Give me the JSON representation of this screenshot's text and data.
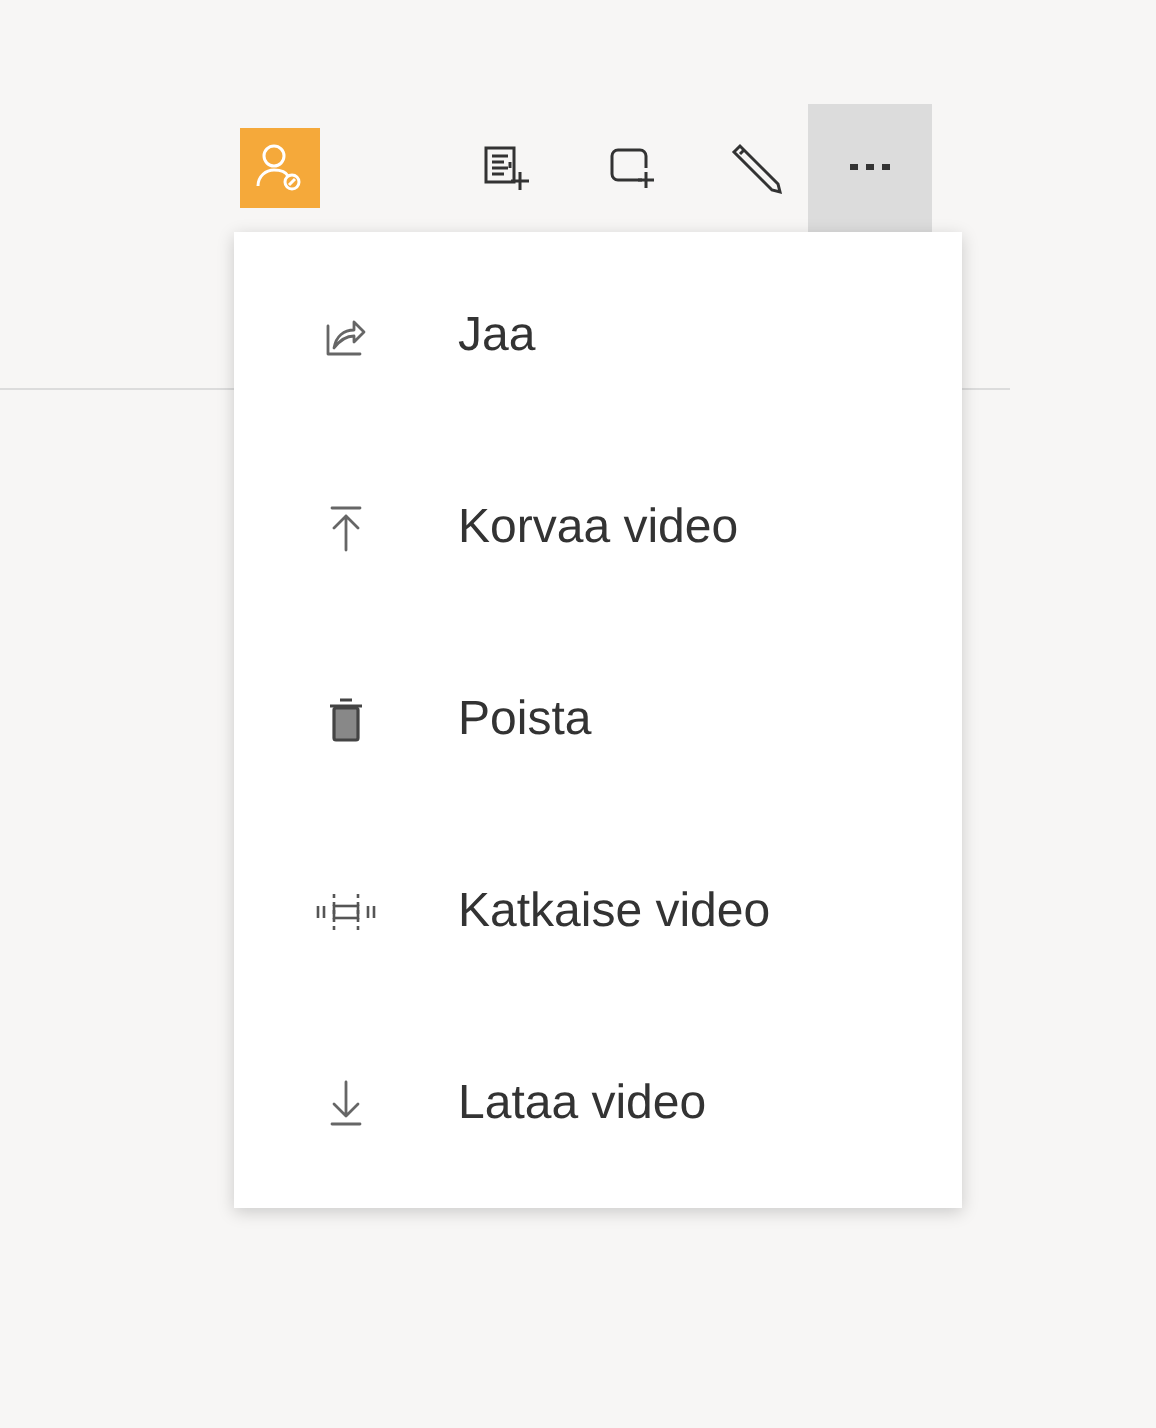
{
  "toolbar": {
    "more_button": {
      "expanded": true
    }
  },
  "menu": {
    "items": [
      {
        "kind": "share",
        "label": "Jaa"
      },
      {
        "kind": "replace",
        "label": "Korvaa video"
      },
      {
        "kind": "delete",
        "label": "Poista"
      },
      {
        "kind": "trim",
        "label": "Katkaise video"
      },
      {
        "kind": "download",
        "label": "Lataa video"
      }
    ]
  }
}
